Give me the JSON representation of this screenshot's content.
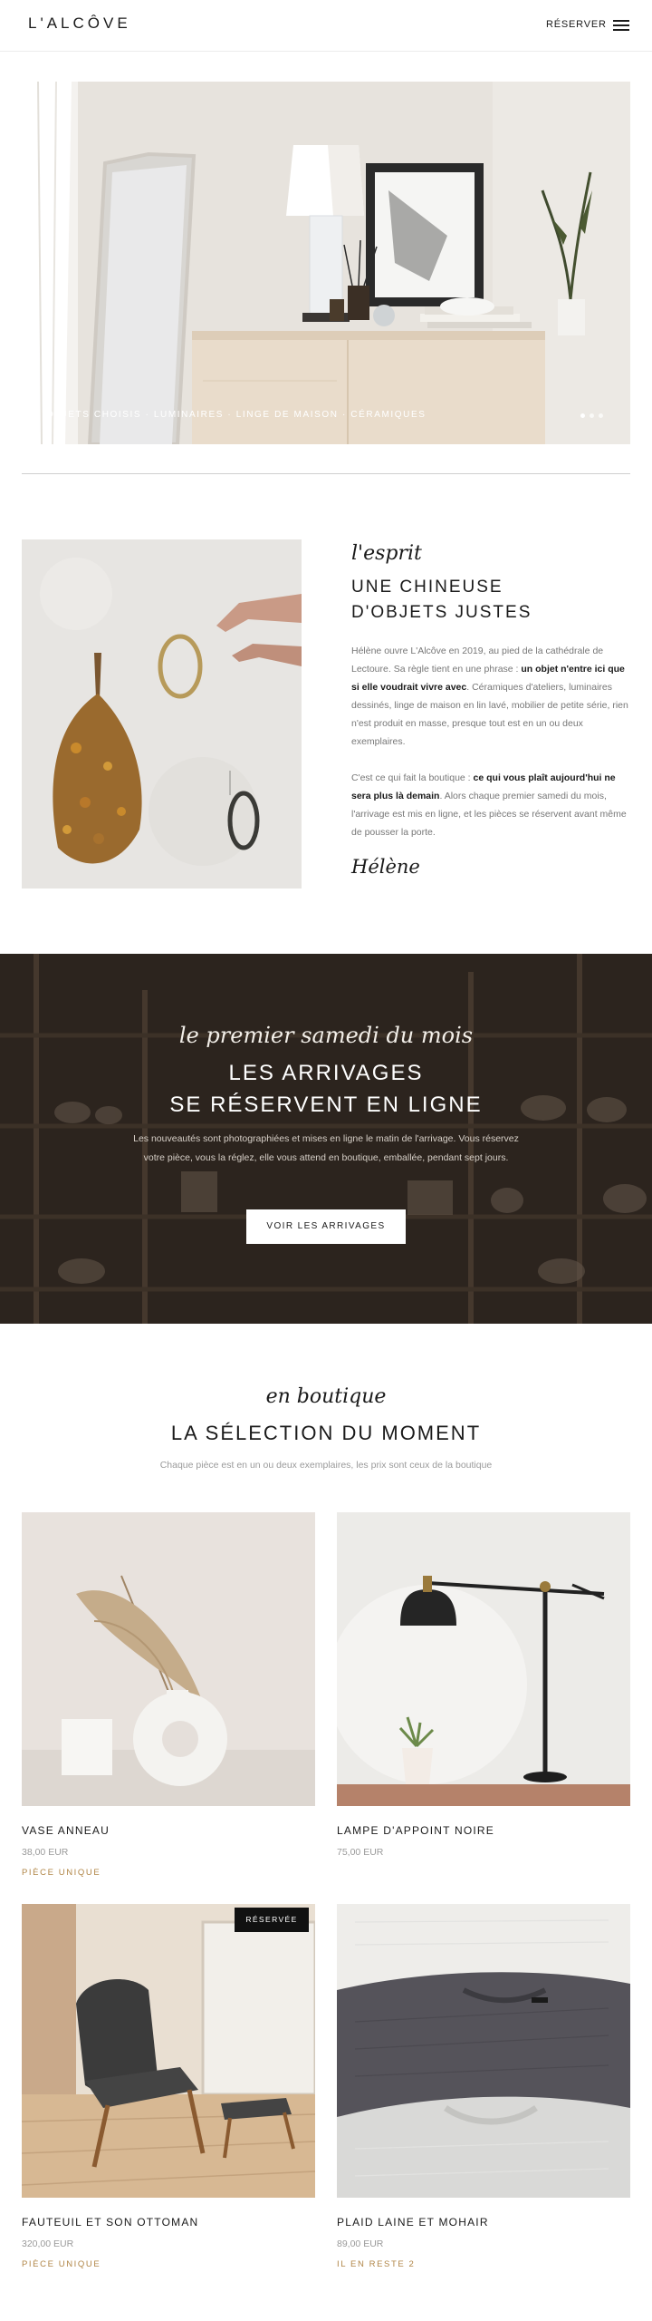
{
  "header": {
    "logo": "L'ALCÔVE",
    "reserve_label": "RÉSERVER",
    "menu_icon": "hamburger-menu-icon"
  },
  "hero": {
    "caption": "OBJETS CHOISIS · LUMINAIRES · LINGE DE MAISON · CÉRAMIQUES",
    "slides_count": 3,
    "active_slide": 1
  },
  "esprit": {
    "kicker": "l'esprit",
    "title_line1": "UNE CHINEUSE",
    "title_line2": "D'OBJETS JUSTES",
    "para1_a": "Hélène ouvre L'Alcôve en 2019, au pied de la cathédrale de Lectoure. Sa règle tient en une phrase : ",
    "para1_b": "un objet n'entre ici que si elle voudrait vivre avec",
    "para1_c": ". Céramiques d'ateliers, luminaires dessinés, linge de maison en lin lavé, mobilier de petite série, rien n'est produit en masse, presque tout est en un ou deux exemplaires.",
    "para2_a": "C'est ce qui fait la boutique : ",
    "para2_b": "ce qui vous plaît aujourd'hui ne sera plus là demain",
    "para2_c": ". Alors chaque premier samedi du mois, l'arrivage est mis en ligne, et les pièces se réservent avant même de pousser la porte.",
    "signature": "Hélène"
  },
  "arrivages": {
    "kicker": "le premier samedi du mois",
    "title_line1": "LES ARRIVAGES",
    "title_line2": "SE RÉSERVENT EN LIGNE",
    "text": "Les nouveautés sont photographiées et mises en ligne le matin de l'arrivage. Vous réservez votre pièce, vous la réglez, elle vous attend en boutique, emballée, pendant sept jours.",
    "button_label": "VOIR LES ARRIVAGES"
  },
  "selection": {
    "kicker": "en boutique",
    "title": "LA SÉLECTION DU MOMENT",
    "subtitle": "Chaque pièce est en un ou deux exemplaires, les prix sont ceux de la boutique",
    "products": [
      {
        "name": "VASE ANNEAU",
        "price": "38,00 EUR",
        "tag": "PIÈCE UNIQUE"
      },
      {
        "name": "LAMPE D'APPOINT NOIRE",
        "price": "75,00 EUR",
        "tag": ""
      },
      {
        "name": "FAUTEUIL ET SON OTTOMAN",
        "price": "320,00 EUR",
        "tag": "PIÈCE UNIQUE",
        "badge": "RÉSERVÉE"
      },
      {
        "name": "PLAID LAINE ET MOHAIR",
        "price": "89,00 EUR",
        "tag": "IL EN RESTE 2"
      }
    ]
  },
  "colors": {
    "accent_gold": "#b08546",
    "text_dark": "#1a1a1a",
    "text_muted": "#9a9a9a",
    "badge_bg": "#111111"
  }
}
